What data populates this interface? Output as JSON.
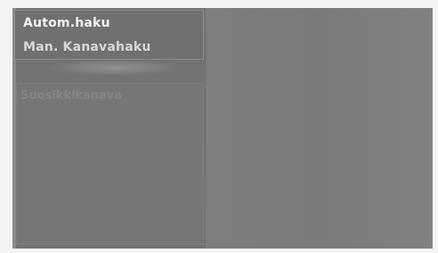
{
  "menu": {
    "items": [
      {
        "label": "Autom.haku",
        "selected": true
      },
      {
        "label": "Man. Kanavahaku",
        "selected": false
      }
    ]
  },
  "submenu": {
    "title": "Suosikkikanava"
  }
}
